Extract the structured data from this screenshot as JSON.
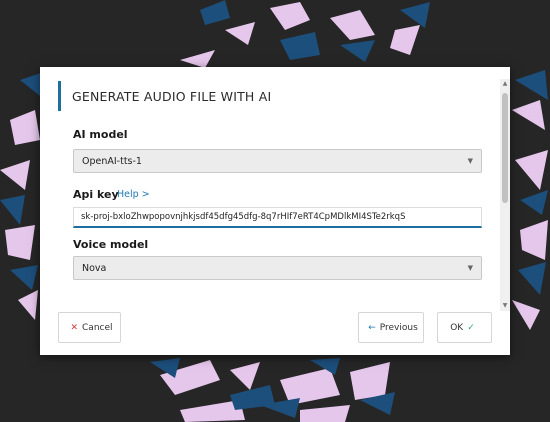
{
  "dialog": {
    "title": "GENERATE AUDIO FILE WITH AI",
    "ai_model": {
      "label": "AI model",
      "value": "OpenAI-tts-1"
    },
    "api_key": {
      "label": "Api key",
      "help_label": "Help >",
      "value": "sk-proj-bxloZhwpopovnjhkjsdf45dfg45dfg-8q7rHIf7eRT4CpMDlkMI4STe2rkqS"
    },
    "voice_model": {
      "label": "Voice model",
      "value": "Nova"
    },
    "buttons": {
      "cancel": "Cancel",
      "previous": "Previous",
      "ok": "OK"
    }
  },
  "colors": {
    "accent": "#1e6fa0",
    "background": "#262626",
    "art_blue": "#1c4f7c",
    "art_pink": "#e6c7ec"
  }
}
